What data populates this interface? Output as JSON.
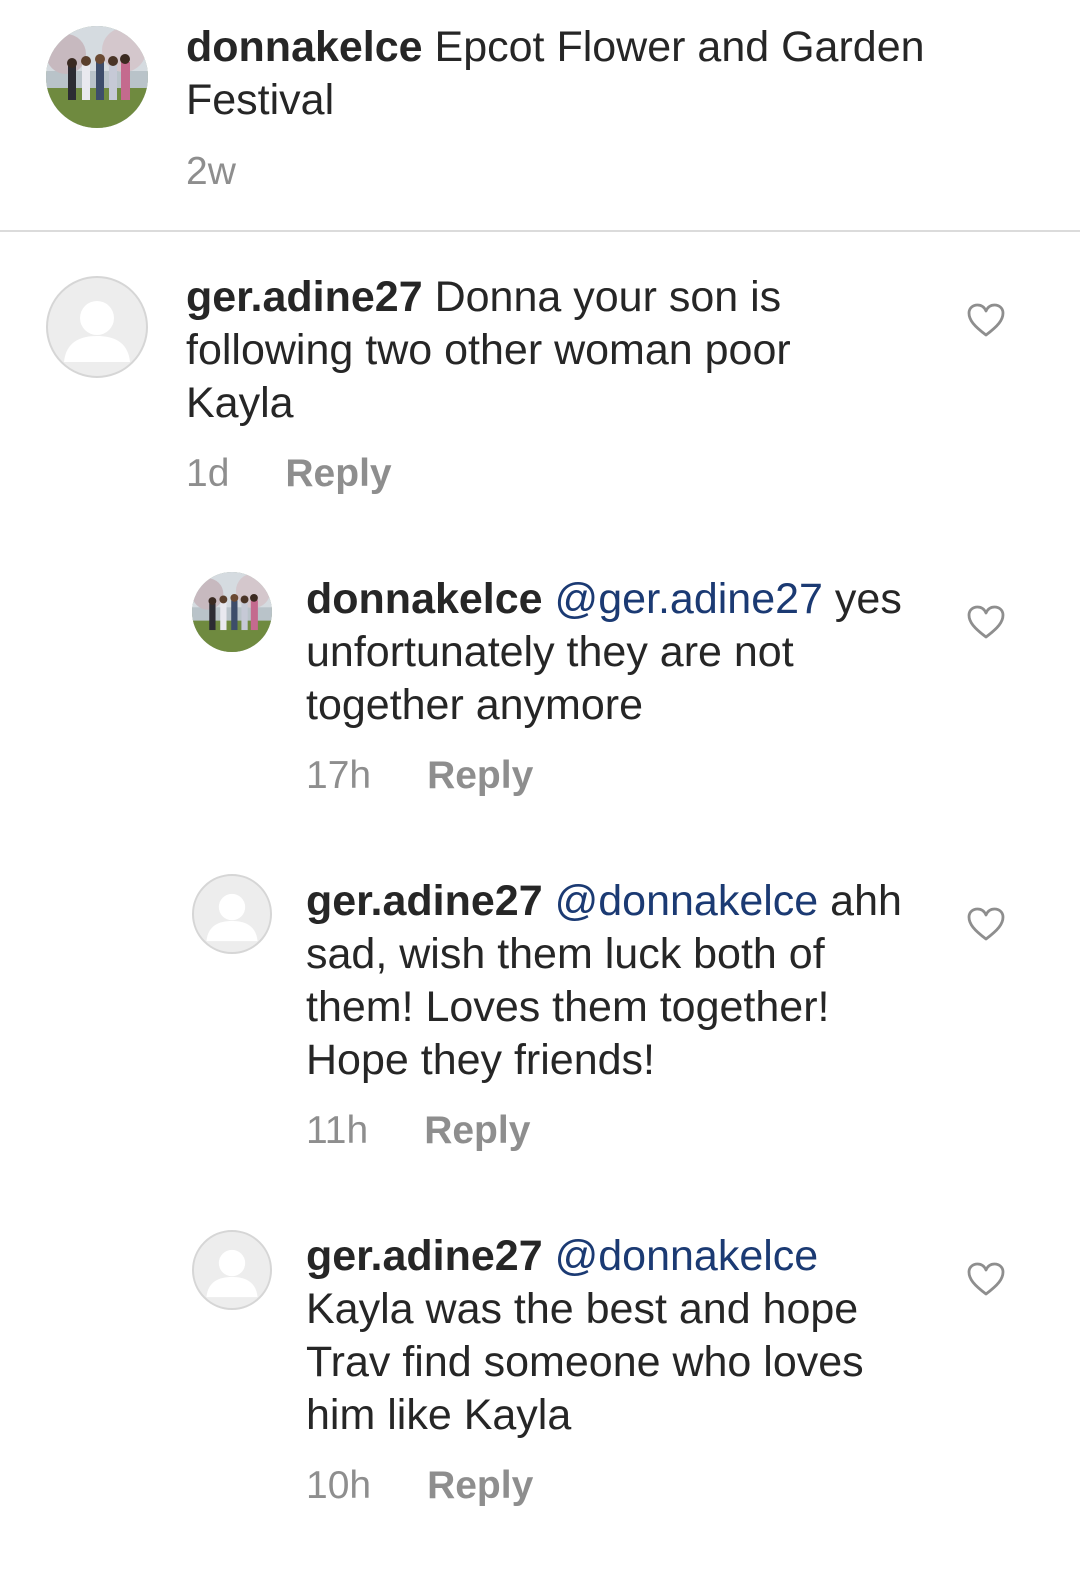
{
  "caption": {
    "username": "donnakelce",
    "text": "Epcot Flower and Garden Festival",
    "time": "2w"
  },
  "comments": [
    {
      "username": "ger.adine27",
      "mention": "",
      "text": "Donna your son is following two other woman poor Kayla",
      "time": "1d",
      "reply_label": "Reply",
      "avatar": "default-avatar",
      "liked": false
    },
    {
      "username": "donnakelce",
      "mention": "@ger.adine27",
      "text": "yes unfortunately they are not together anymore",
      "time": "17h",
      "reply_label": "Reply",
      "avatar": "profile-photo",
      "liked": false
    },
    {
      "username": "ger.adine27",
      "mention": "@donnakelce",
      "text": "ahh sad, wish them luck both of them! Loves them together! Hope they friends!",
      "time": "11h",
      "reply_label": "Reply",
      "avatar": "default-avatar",
      "liked": false
    },
    {
      "username": "ger.adine27",
      "mention": "@donnakelce",
      "text": "Kayla was the best and hope Trav find someone who loves him like Kayla",
      "time": "10h",
      "reply_label": "Reply",
      "avatar": "default-avatar",
      "liked": false
    }
  ],
  "colors": {
    "text": "#262626",
    "secondary": "#8e8e8e",
    "mention": "#1b3a73",
    "divider": "#dbdbdb"
  },
  "icons": {
    "like": "heart-outline-icon",
    "default_avatar": "person-silhouette-icon"
  }
}
